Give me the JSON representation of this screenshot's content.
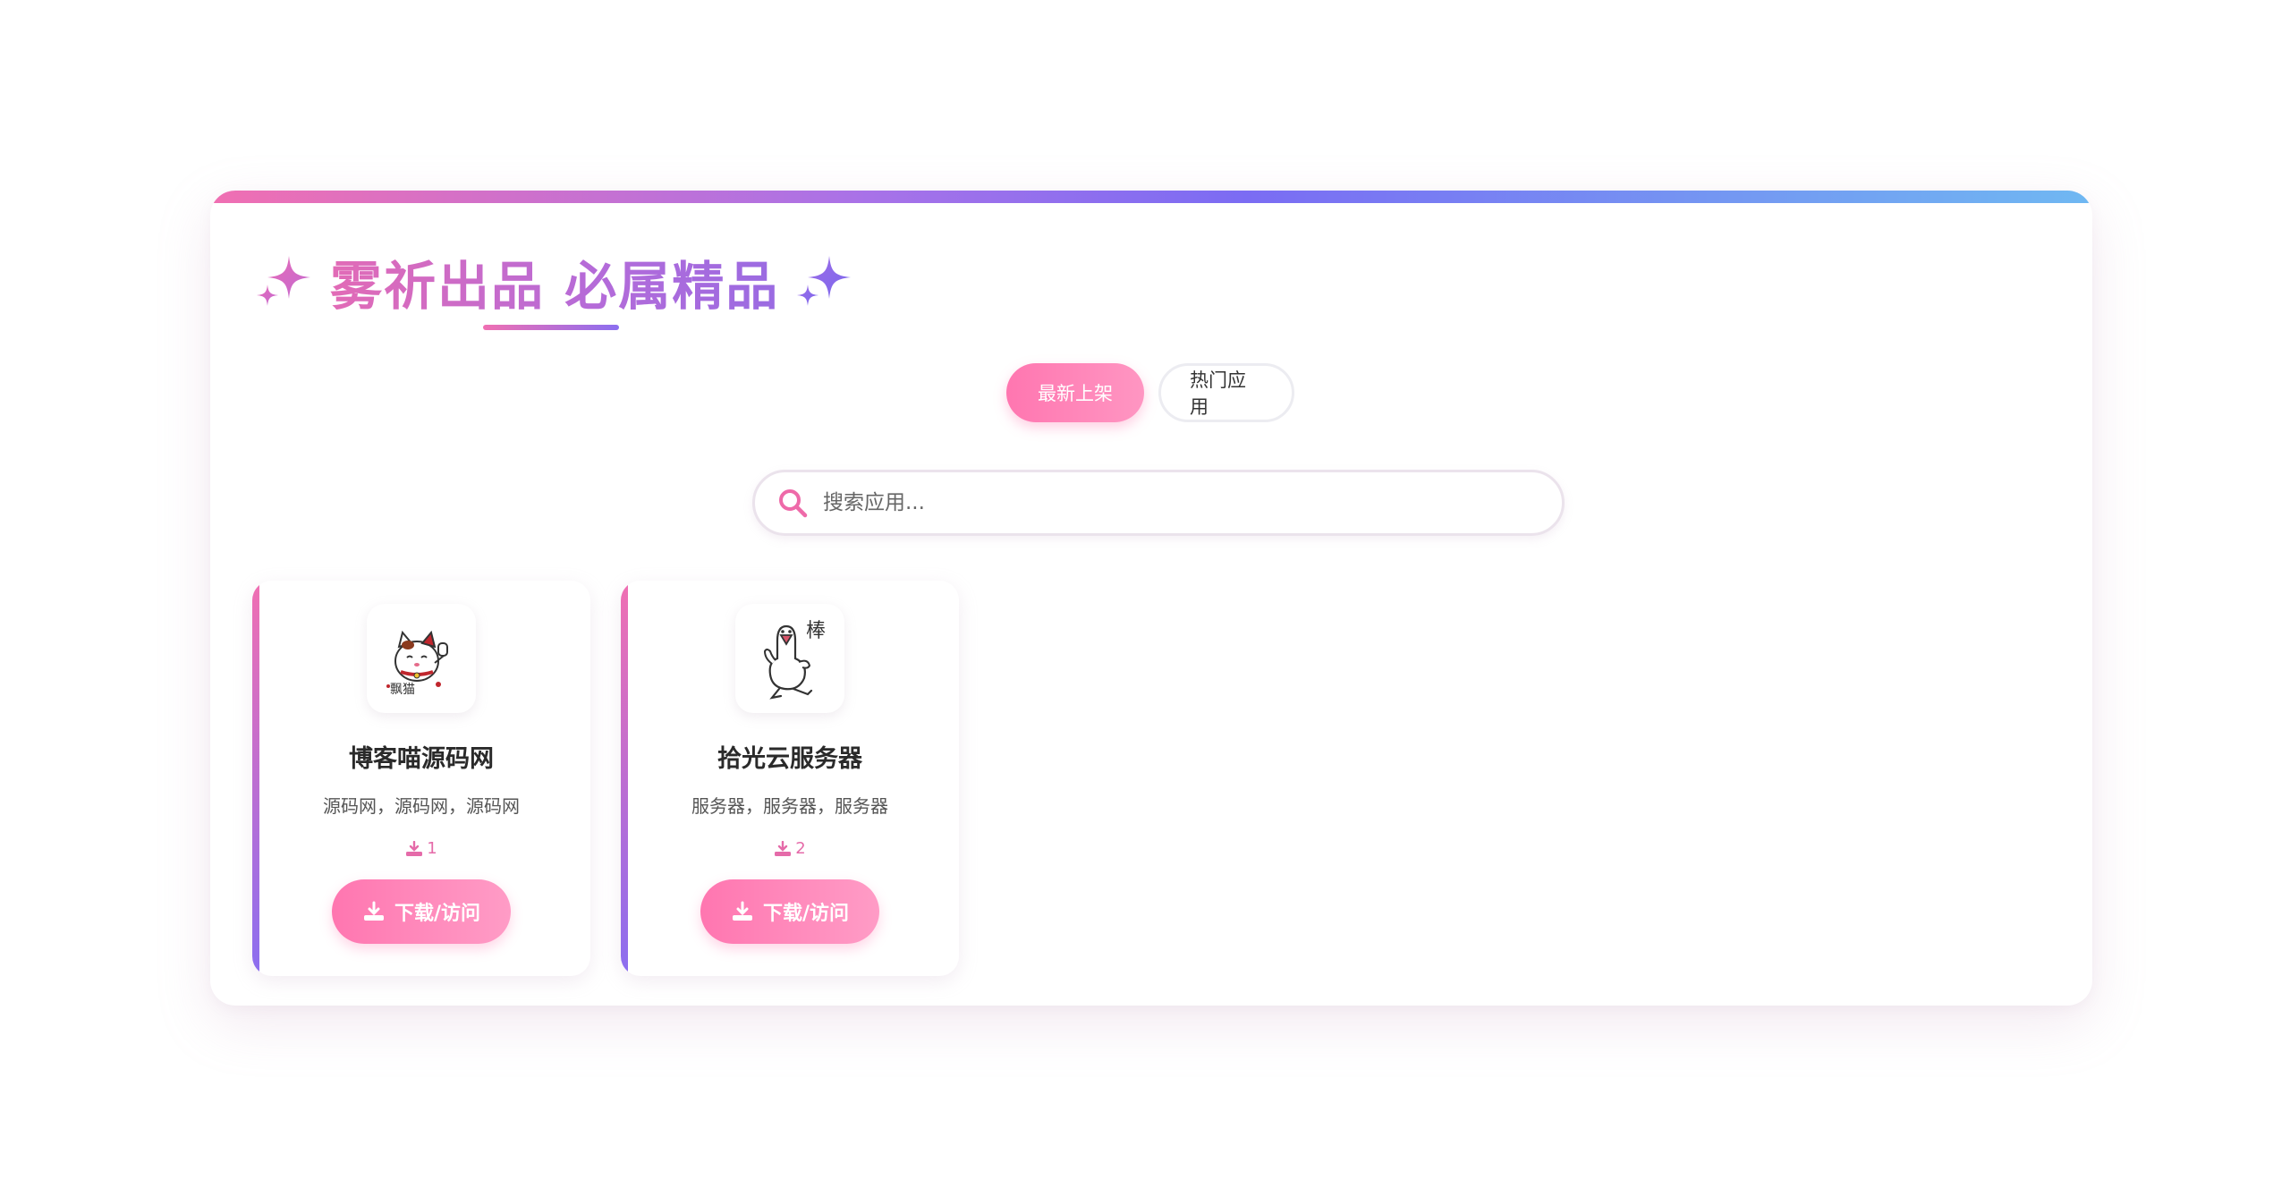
{
  "header": {
    "title": "雾祈出品 必属精品",
    "sparkle_icon": "sparkles-icon"
  },
  "tabs": [
    {
      "label": "最新上架",
      "active": true
    },
    {
      "label": "热门应用",
      "active": false
    }
  ],
  "search": {
    "placeholder": "搜索应用...",
    "value": ""
  },
  "apps": [
    {
      "name": "博客喵源码网",
      "description": "源码网，源码网，源码网",
      "downloads": "1",
      "button_label": "下载/访问",
      "icon": "lucky-cat-icon"
    },
    {
      "name": "拾光云服务器",
      "description": "服务器，服务器，服务器",
      "downloads": "2",
      "button_label": "下载/访问",
      "icon": "goose-thumbs-up-icon"
    }
  ],
  "colors": {
    "accent_pink": "#ff76b0",
    "accent_purple": "#8b6ef0",
    "accent_blue": "#6fb8f2"
  }
}
